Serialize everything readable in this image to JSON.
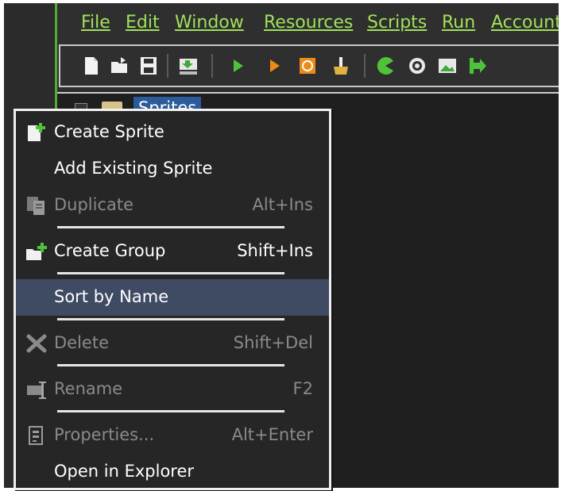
{
  "menubar": {
    "items": [
      {
        "label": "File"
      },
      {
        "label": "Edit"
      },
      {
        "label": "Window"
      },
      {
        "label": "Resources"
      },
      {
        "label": "Scripts"
      },
      {
        "label": "Run"
      },
      {
        "label": "Account"
      }
    ]
  },
  "toolbar": {
    "icons": [
      "new-file-icon",
      "open-folder-icon",
      "save-icon",
      "export-icon",
      "run-icon",
      "debug-run-icon",
      "stop-icon",
      "clean-icon",
      "pacman-icon",
      "target-icon",
      "image-icon",
      "arrow-icon"
    ]
  },
  "tree": {
    "root_label": "Sprites"
  },
  "context_menu": {
    "items": [
      {
        "label": "Create Sprite",
        "shortcut": "",
        "enabled": true,
        "highlighted": false,
        "icon": "create-sprite-icon"
      },
      {
        "label": "Add Existing Sprite",
        "shortcut": "",
        "enabled": true,
        "highlighted": false,
        "icon": ""
      },
      {
        "label": "Duplicate",
        "shortcut": "Alt+Ins",
        "enabled": false,
        "highlighted": false,
        "icon": "duplicate-icon"
      },
      {
        "label": "Create Group",
        "shortcut": "Shift+Ins",
        "enabled": true,
        "highlighted": false,
        "icon": "create-group-icon"
      },
      {
        "label": "Sort by Name",
        "shortcut": "",
        "enabled": true,
        "highlighted": true,
        "icon": ""
      },
      {
        "label": "Delete",
        "shortcut": "Shift+Del",
        "enabled": false,
        "highlighted": false,
        "icon": "delete-icon"
      },
      {
        "label": "Rename",
        "shortcut": "F2",
        "enabled": false,
        "highlighted": false,
        "icon": "rename-icon"
      },
      {
        "label": "Properties...",
        "shortcut": "Alt+Enter",
        "enabled": false,
        "highlighted": false,
        "icon": "properties-icon"
      },
      {
        "label": "Open in Explorer",
        "shortcut": "",
        "enabled": true,
        "highlighted": false,
        "icon": ""
      }
    ]
  },
  "colors": {
    "accent_green": "#9fe25a",
    "highlight": "#3f4b63",
    "selection_blue": "#2c5b9c"
  }
}
